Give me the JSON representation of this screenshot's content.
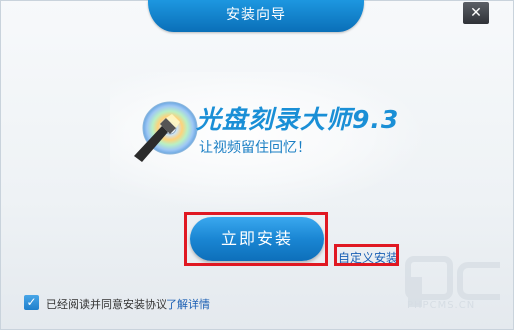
{
  "window": {
    "title": "安装向导",
    "close_glyph": "✕"
  },
  "banner": {
    "product_name": "光盘刻录大师9.3",
    "slogan": "让视频留住回忆！",
    "logo_icon": "cd-torch-logo-icon"
  },
  "actions": {
    "install_label": "立即安装",
    "custom_install_label": "自定义安装"
  },
  "agreement": {
    "checked": true,
    "check_glyph": "✓",
    "text": "已经阅读并同意安装协议",
    "detail_link": "了解详情"
  },
  "watermark": {
    "text": "PHPCMS.CN"
  },
  "colors": {
    "accent": "#1a8fd6",
    "highlight": "#e01822"
  }
}
